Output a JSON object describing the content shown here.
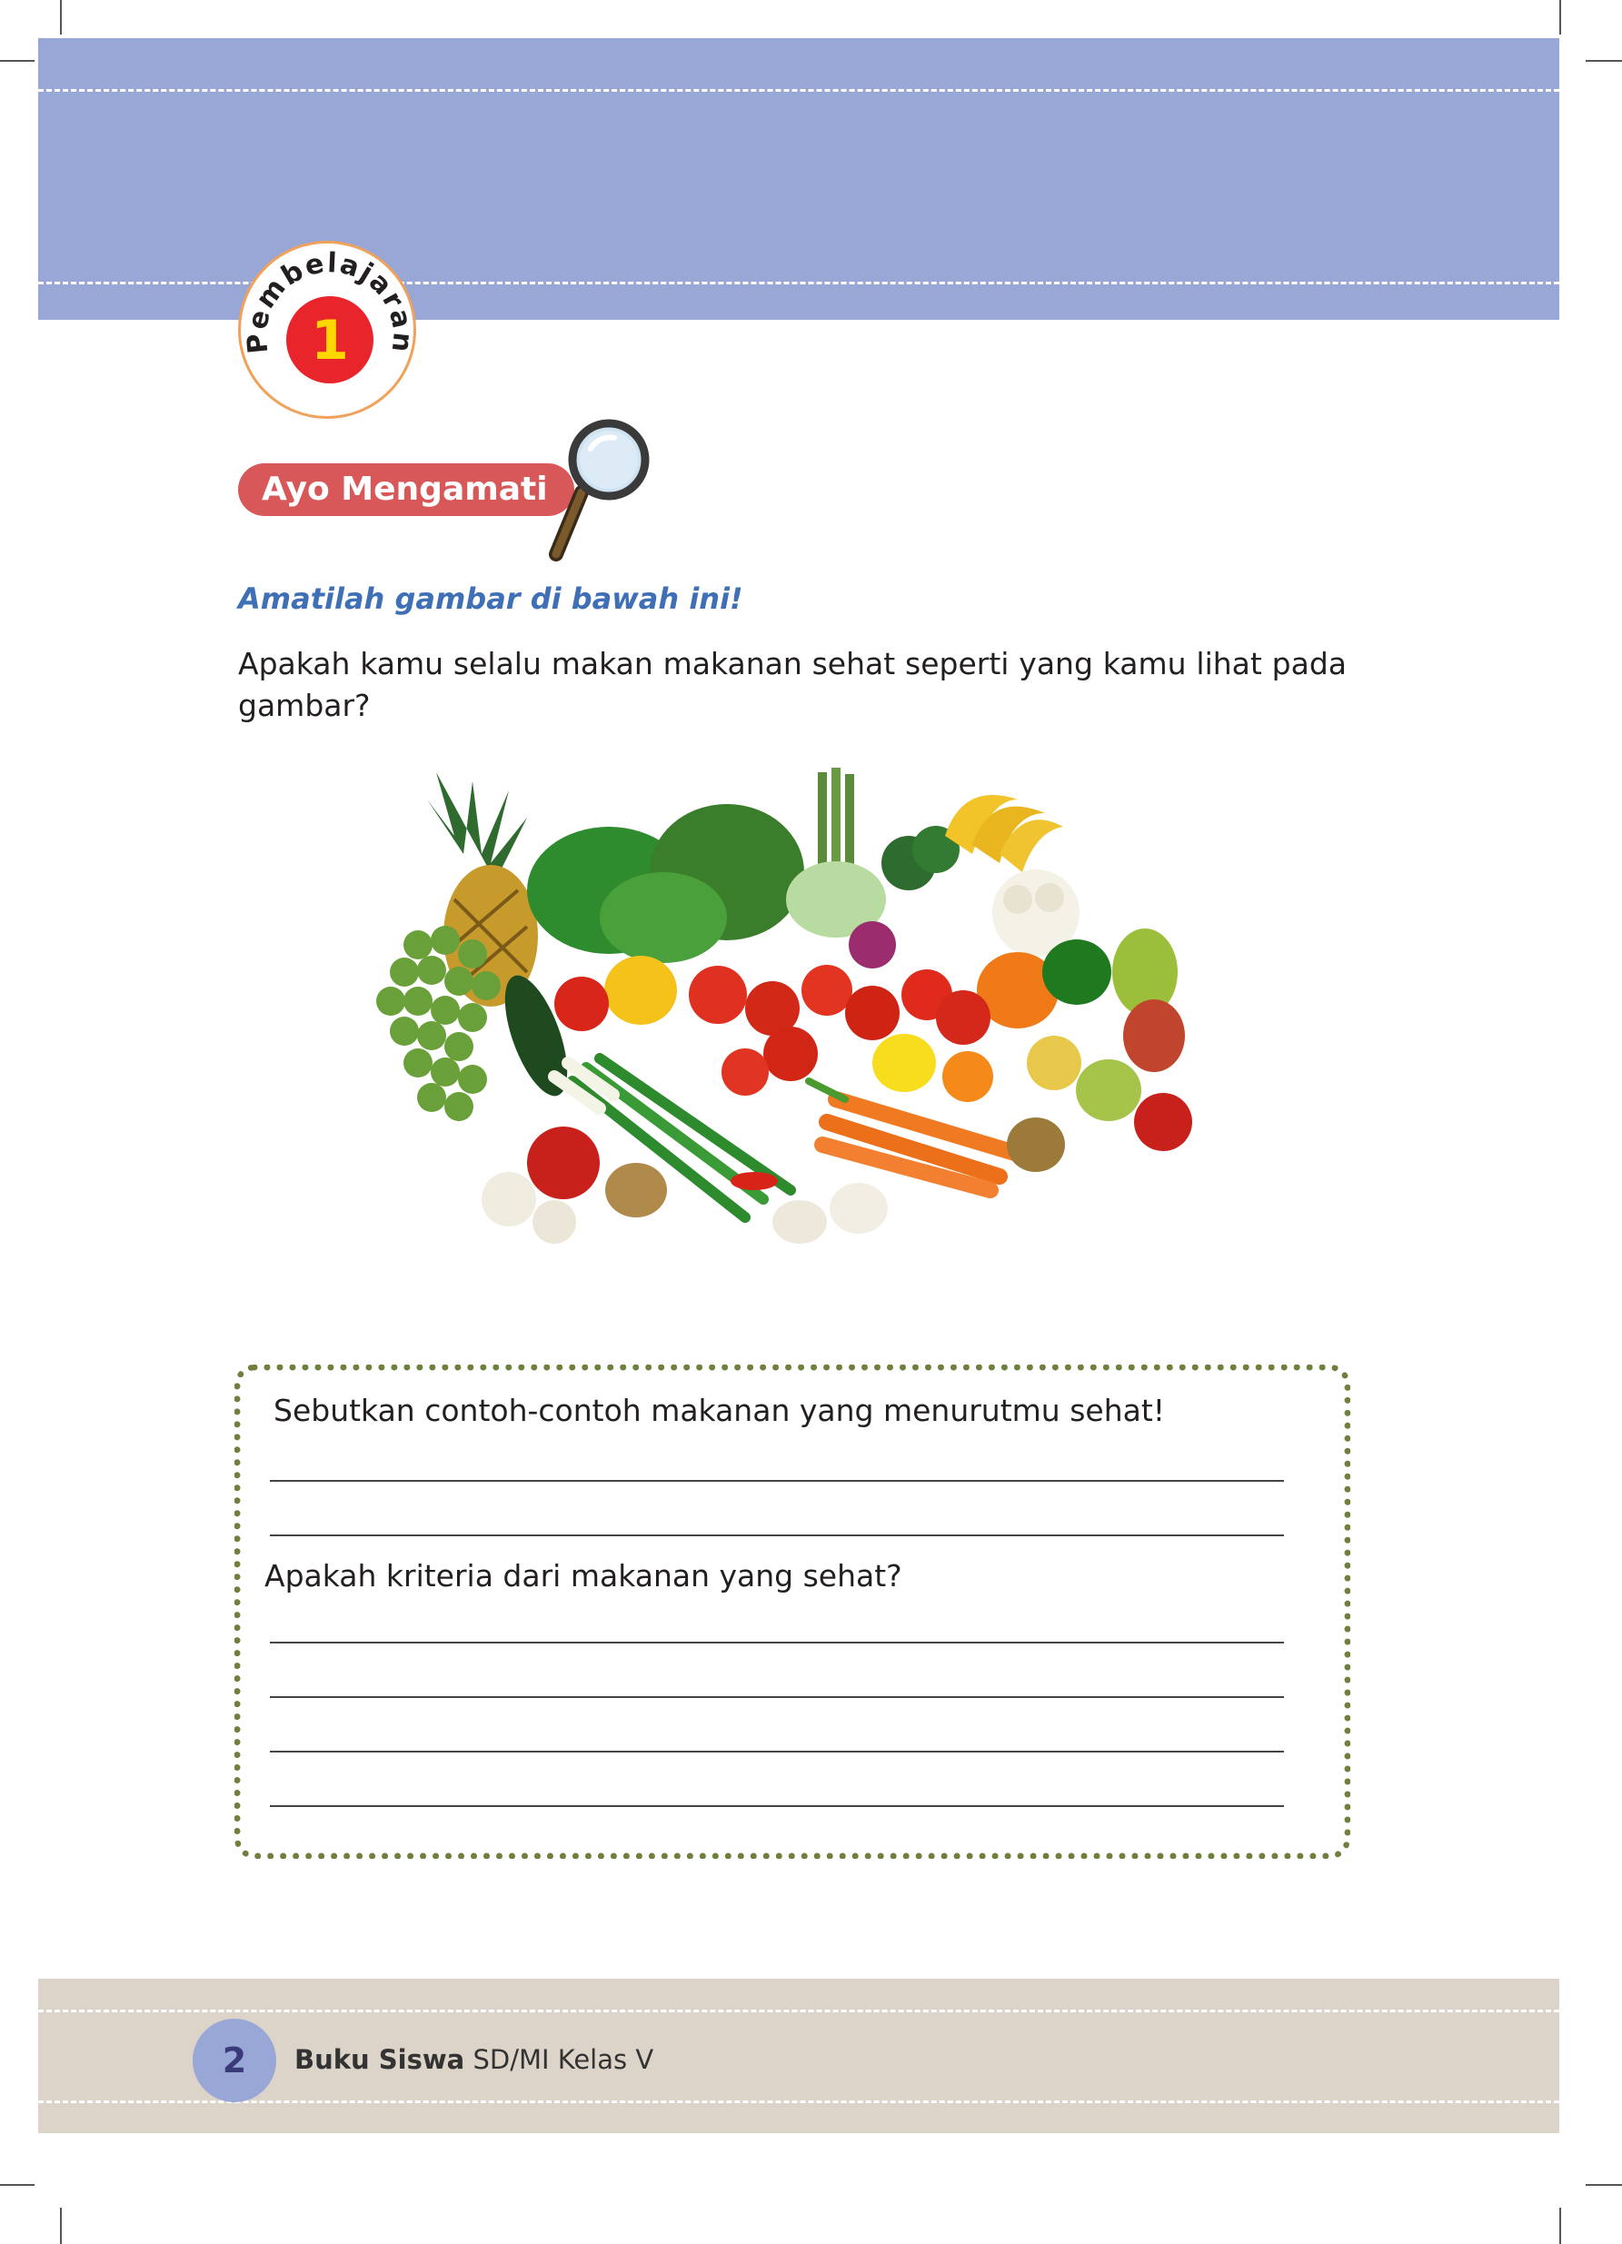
{
  "lesson": {
    "label": "Pembelajaran",
    "number": "1"
  },
  "activity": {
    "title": "Ayo Mengamati"
  },
  "instruction": "Amatilah gambar di bawah ini!",
  "question_intro": "Apakah kamu selalu makan makanan sehat seperti yang kamu lihat pada gambar?",
  "answer_box": {
    "question1": "Sebutkan contoh-contoh makanan yang menurutmu sehat!",
    "question2": "Apakah kriteria dari makanan yang sehat?"
  },
  "footer": {
    "page_number": "2",
    "book_title_bold": "Buku Siswa",
    "book_title_rest": " SD/MI Kelas V"
  },
  "colors": {
    "header": "#98a7d5",
    "tag": "#d8585a",
    "instruction": "#3f6fb5",
    "dotted_border": "#6f7f3d",
    "footer": "#dcd4c8",
    "badge_circle": "#e8252a"
  },
  "icons": [
    "magnifier-icon",
    "lesson-badge-icon"
  ]
}
